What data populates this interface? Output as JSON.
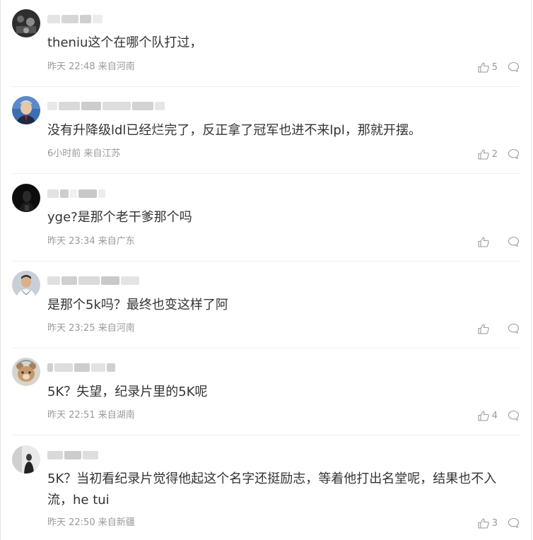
{
  "comments": [
    {
      "text": "theniu这个在哪个队打过，",
      "time": "昨天 22:48",
      "location": "来自河南",
      "likes": "5",
      "avatar_icon": "avatar-dark"
    },
    {
      "text": "没有升降级ldl已经烂完了，反正拿了冠军也进不来lpl，那就开摆。",
      "time": "6小时前",
      "location": "来自江苏",
      "likes": "2",
      "avatar_icon": "avatar-man-suit"
    },
    {
      "text": "yge?是那个老干爹那个吗",
      "time": "昨天 23:34",
      "location": "来自广东",
      "likes": "",
      "avatar_icon": "avatar-dark-figure"
    },
    {
      "text": "是那个5k吗？最终也变这样了阿",
      "time": "昨天 23:25",
      "location": "来自河南",
      "likes": "",
      "avatar_icon": "avatar-photo"
    },
    {
      "text": "5K？失望，纪录片里的5K呢",
      "time": "昨天 22:51",
      "location": "来自湖南",
      "likes": "4",
      "avatar_icon": "avatar-bear"
    },
    {
      "text": "5K？当初看纪录片觉得他起这个名字还挺励志，等着他打出名堂呢，结果也不入流，he tui",
      "time": "昨天 22:50",
      "location": "来自新疆",
      "likes": "3",
      "avatar_icon": "avatar-figure"
    }
  ],
  "colors": {
    "text": "#333333",
    "meta": "#999999",
    "divider": "#eeeeee"
  }
}
